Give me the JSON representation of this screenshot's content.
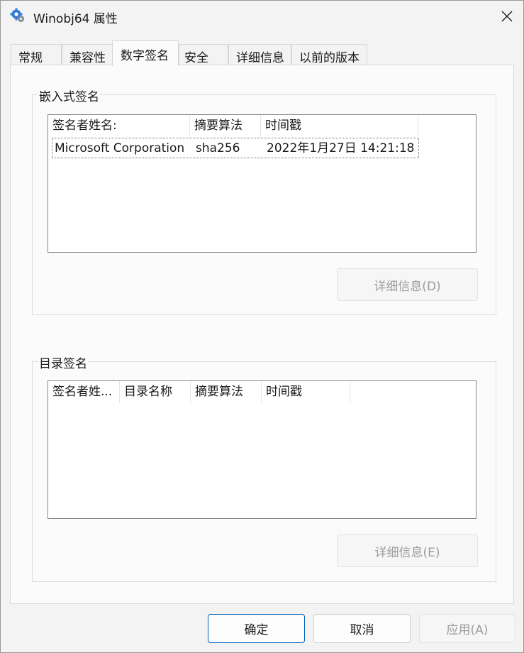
{
  "window": {
    "title": "Winobj64 属性"
  },
  "tabs": [
    {
      "label": "常规"
    },
    {
      "label": "兼容性"
    },
    {
      "label": "数字签名"
    },
    {
      "label": "安全"
    },
    {
      "label": "详细信息"
    },
    {
      "label": "以前的版本"
    }
  ],
  "embedded": {
    "group_title": "嵌入式签名",
    "columns": [
      "签名者姓名:",
      "摘要算法",
      "时间戳"
    ],
    "rows": [
      [
        "Microsoft Corporation",
        "sha256",
        "2022年1月27日 14:21:18"
      ]
    ],
    "details_button": "详细信息(D)"
  },
  "catalog": {
    "group_title": "目录签名",
    "columns": [
      "签名者姓...",
      "目录名称",
      "摘要算法",
      "时间戳"
    ],
    "details_button": "详细信息(E)"
  },
  "footer": {
    "ok": "确定",
    "cancel": "取消",
    "apply": "应用(A)"
  },
  "colors": {
    "accent": "#005fb8",
    "disabled_text": "#9c9c9c"
  },
  "icons": {
    "app": "gear-shield-icon",
    "close": "close-icon"
  }
}
